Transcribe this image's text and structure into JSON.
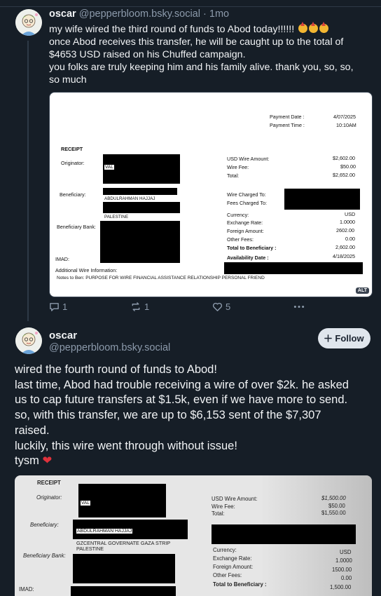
{
  "post1": {
    "name": "oscar",
    "handle": "@pepperbloom.bsky.social",
    "separator": "·",
    "time": "1mo",
    "lines": [
      "my wife wired the third round of funds to Abod today!!!!!!",
      "once Abod receives this transfer, he will be caught up to the total of",
      "$4653 USD raised on his Chuffed campaign.",
      "you folks are truly keeping him and his family alive. thank you, so, so,",
      "so much"
    ],
    "emoji": "party-face",
    "receipt": {
      "payment_date_label": "Payment Date :",
      "payment_date": "4/07/2025",
      "payment_time_label": "Payment Time :",
      "payment_time": "10:10AM",
      "title": "RECEIPT",
      "originator_label": "Originator:",
      "originator_visible": "VAL",
      "beneficiary_label": "Beneficiary:",
      "beneficiary_name": "ABDULRAHMAN HAJJAJ",
      "beneficiary_country": "PALESTINE",
      "beneficiary_bank_label": "Beneficiary Bank:",
      "imad_label": "IMAD:",
      "usd_wire_amount_label": "USD Wire Amount:",
      "usd_wire_amount": "$2,602.00",
      "wire_fee_label": "Wire Fee:",
      "wire_fee": "$50.00",
      "total_label": "Total:",
      "total": "$2,652.00",
      "wire_charged_to_label": "Wire Charged To:",
      "fees_charged_to_label": "Fees Charged To:",
      "currency_label": "Currency:",
      "currency": "USD",
      "exchange_rate_label": "Exchange Rate:",
      "exchange_rate": "1.0000",
      "foreign_amount_label": "Foreign Amount:",
      "foreign_amount": "2602.00",
      "other_fees_label": "Other Fees:",
      "other_fees": "0.00",
      "total_to_beneficiary_label": "Total to Beneficiary :",
      "total_to_beneficiary": "2,602.00",
      "availability_date_label": "Availability Date :",
      "availability_date": "4/18/2025",
      "additional_info_label": "Additional Wire Information:",
      "notes": "Notes to Ben: PURPOSE FOR WIRE FINANCIAL ASSISTANCE RELATIONSHIP PERSONAL FRIEND",
      "alt_badge": "ALT"
    },
    "actions": {
      "replies": "1",
      "reposts": "1",
      "likes": "5"
    }
  },
  "post2": {
    "name": "oscar",
    "handle": "@pepperbloom.bsky.social",
    "follow_label": "Follow",
    "lines": [
      "wired the fourth round of funds to Abod!",
      "last time, Abod had trouble receiving a wire of over $2k. he asked",
      "us to cap future transfers at $1.5k, even if we have more to send.",
      "so, with this transfer, we are up to $6,153 sent of the $7,307",
      "raised.",
      "luckily, this wire went through without issue!",
      "tysm"
    ],
    "receipt": {
      "title": "RECEIPT",
      "originator_label": "Originator:",
      "originator_visible": "VAL",
      "beneficiary_label": "Beneficiary:",
      "beneficiary_name": "ABDULRAHMAN HAJJAJ",
      "beneficiary_address": "GZCENTRAL GOVERNATE GAZA STRIP",
      "beneficiary_country": "PALESTINE",
      "beneficiary_bank_label": "Beneficiary Bank:",
      "imad_label": "IMAD:",
      "usd_wire_amount_label": "USD Wire Amount:",
      "usd_wire_amount": "$1,500.00",
      "wire_fee_label": "Wire Fee:",
      "wire_fee": "$50.00",
      "total_label": "Total:",
      "total": "$1,550.00",
      "currency_label": "Currency:",
      "currency": "USD",
      "exchange_rate_label": "Exchange Rate:",
      "exchange_rate": "1.0000",
      "foreign_amount_label": "Foreign Amount:",
      "foreign_amount": "1500.00",
      "other_fees_label": "Other Fees:",
      "other_fees": "0.00",
      "total_to_beneficiary_label": "Total to Beneficiary :",
      "total_to_beneficiary": "1,500.00"
    }
  },
  "colors": {
    "background": "#161e27",
    "muted": "#8c9aab",
    "follow_bg": "#e0e6ed",
    "heart": "#e0323c"
  }
}
